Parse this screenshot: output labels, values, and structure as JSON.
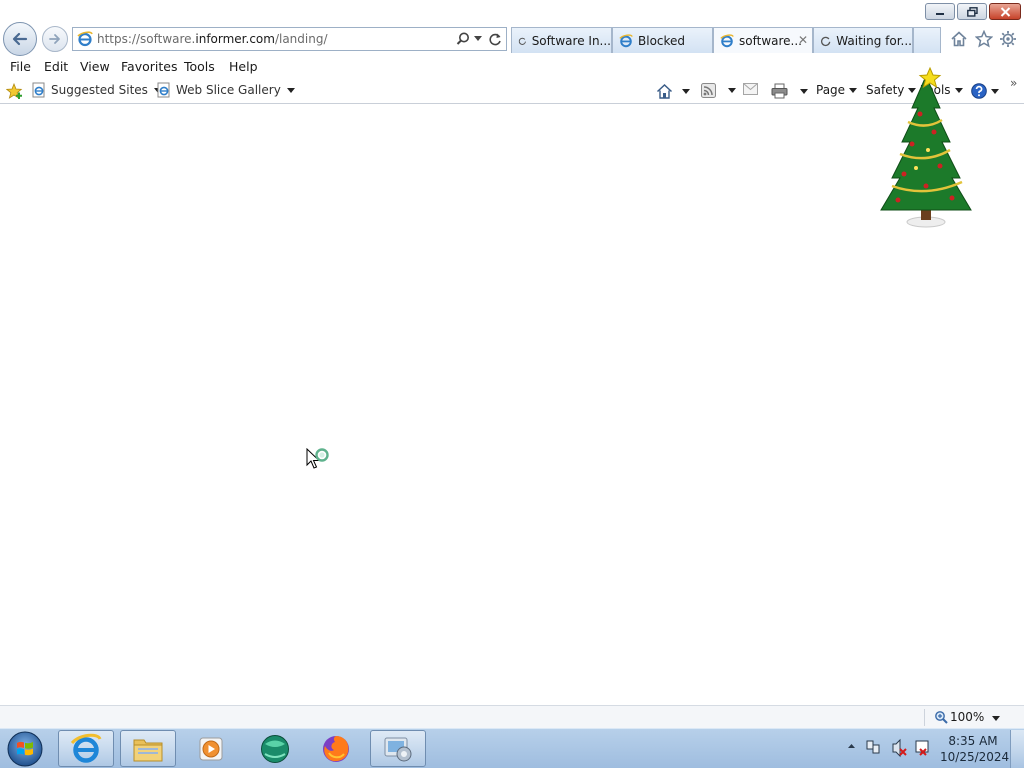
{
  "address_bar": {
    "url_prefix": "https://software.",
    "url_domain": "informer.com",
    "url_path": "/landing/"
  },
  "tabs": [
    {
      "label": "Software In...",
      "state": "loading"
    },
    {
      "label": "Blocked",
      "state": "ie"
    },
    {
      "label": "software...",
      "state": "active"
    },
    {
      "label": "Waiting for...",
      "state": "loading"
    }
  ],
  "menu": [
    "File",
    "Edit",
    "View",
    "Favorites",
    "Tools",
    "Help"
  ],
  "favorites": {
    "suggested_sites": "Suggested Sites",
    "web_slice_gallery": "Web Slice Gallery"
  },
  "command_bar": {
    "page": "Page",
    "safety": "Safety",
    "tools": "Tools"
  },
  "status_bar": {
    "zoom": "100%"
  },
  "taskbar": {
    "time": "8:35 AM",
    "date": "10/25/2024",
    "apps": [
      "internet-explorer",
      "file-explorer",
      "media-player",
      "app-globe",
      "firefox",
      "control-panel"
    ]
  },
  "colors": {
    "taskbar": "#a9c5e4",
    "tab_inactive": "#d8e5f4",
    "close_button": "#c7432a"
  }
}
